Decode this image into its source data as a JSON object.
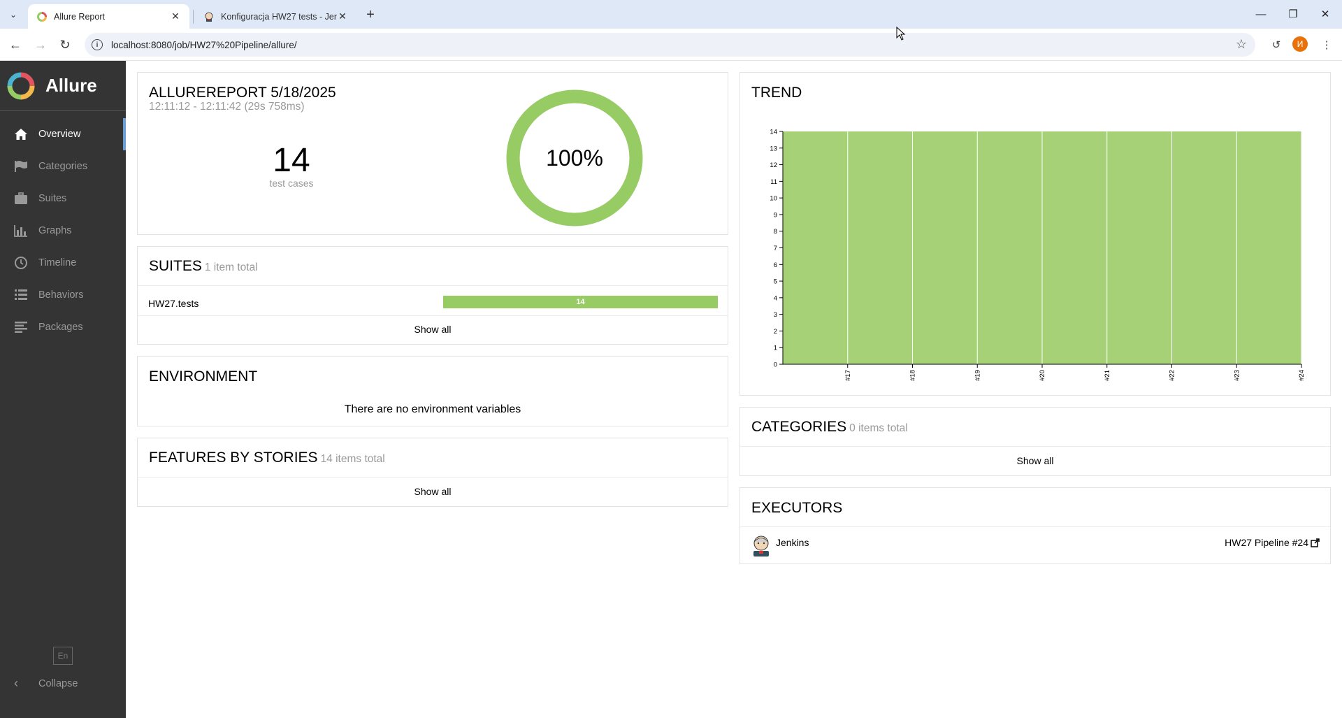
{
  "browser": {
    "tabs": [
      {
        "title": "Allure Report",
        "active": true
      },
      {
        "title": "Konfiguracja HW27 tests - Jenkins",
        "active": false
      }
    ],
    "url": "localhost:8080/job/HW27%20Pipeline/allure/",
    "profile_initial": "И"
  },
  "sidebar": {
    "brand": "Allure",
    "items": [
      {
        "label": "Overview",
        "icon": "home-icon",
        "active": true
      },
      {
        "label": "Categories",
        "icon": "flag-icon",
        "active": false
      },
      {
        "label": "Suites",
        "icon": "briefcase-icon",
        "active": false
      },
      {
        "label": "Graphs",
        "icon": "bar-chart-icon",
        "active": false
      },
      {
        "label": "Timeline",
        "icon": "clock-icon",
        "active": false
      },
      {
        "label": "Behaviors",
        "icon": "list-icon",
        "active": false
      },
      {
        "label": "Packages",
        "icon": "align-left-icon",
        "active": false
      }
    ],
    "language": "En",
    "collapse_label": "Collapse"
  },
  "summary": {
    "title": "ALLUREREPORT 5/18/2025",
    "time_range": "12:11:12 - 12:11:42 (29s 758ms)",
    "test_count": "14",
    "test_count_label": "test cases",
    "pass_rate_label": "100%",
    "pass_rate": 1.0
  },
  "suites": {
    "title": "SUITES",
    "count_label": "1 item total",
    "rows": [
      {
        "name": "HW27.tests",
        "passed": "14"
      }
    ],
    "show_all": "Show all"
  },
  "environment": {
    "title": "ENVIRONMENT",
    "empty_text": "There are no environment variables"
  },
  "features": {
    "title": "FEATURES BY STORIES",
    "count_label": "14 items total",
    "show_all": "Show all"
  },
  "trend": {
    "title": "TREND"
  },
  "categories": {
    "title": "CATEGORIES",
    "count_label": "0 items total",
    "show_all": "Show all"
  },
  "executors": {
    "title": "EXECUTORS",
    "name": "Jenkins",
    "build": "HW27 Pipeline #24"
  },
  "colors": {
    "passed": "#97cc64",
    "sidebar_bg": "#343434",
    "active_indicator": "#6a9fd4"
  },
  "chart_data": {
    "type": "area",
    "title": "TREND",
    "x": [
      "#17",
      "#18",
      "#19",
      "#20",
      "#21",
      "#22",
      "#23",
      "#24"
    ],
    "series": [
      {
        "values": [
          14,
          14,
          14,
          14,
          14,
          14,
          14,
          14
        ]
      }
    ],
    "yticks": [
      "0",
      "1",
      "2",
      "3",
      "4",
      "5",
      "6",
      "7",
      "8",
      "9",
      "10",
      "11",
      "12",
      "13",
      "14"
    ],
    "ylim": [
      0,
      14
    ],
    "color": "#97cc64",
    "grid": "vertical"
  }
}
